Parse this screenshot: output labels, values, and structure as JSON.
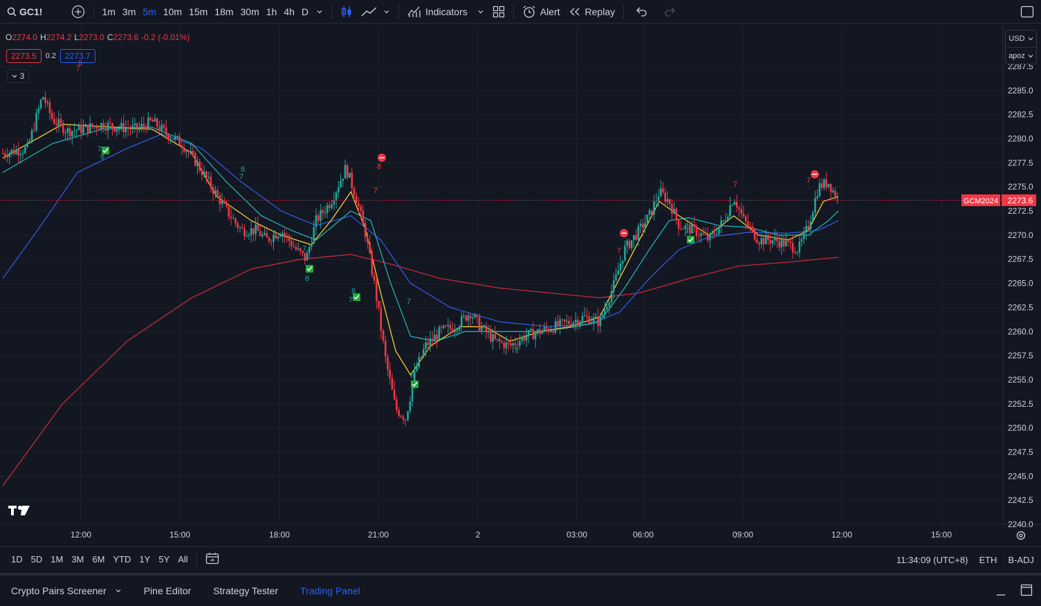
{
  "toolbar": {
    "symbol": "GC1!",
    "intervals": [
      "1m",
      "3m",
      "5m",
      "10m",
      "15m",
      "18m",
      "30m",
      "1h",
      "4h",
      "D"
    ],
    "active_interval": "5m",
    "indicators_label": "Indicators",
    "alert_label": "Alert",
    "replay_label": "Replay"
  },
  "legend": {
    "open_key": "O",
    "open": "2274.0",
    "high_key": "H",
    "high": "2274.2",
    "low_key": "L",
    "low": "2273.0",
    "close_key": "C",
    "close": "2273.6",
    "change": "-0.2 (-0.01%)",
    "sell_price": "2273.5",
    "spread": "0.2",
    "buy_price": "2273.7",
    "collapse_count": "3"
  },
  "scale": {
    "currency": "USD",
    "unit": "apoz",
    "price_labels": [
      "2287.5",
      "2285.0",
      "2282.5",
      "2280.0",
      "2277.5",
      "2275.0",
      "2272.5",
      "2270.0",
      "2267.5",
      "2265.0",
      "2262.5",
      "2260.0",
      "2257.5",
      "2255.0",
      "2252.5",
      "2250.0",
      "2247.5",
      "2245.0",
      "2242.5",
      "2240.0"
    ],
    "symbol_tag": "GCM2024",
    "last_price": "2273.6"
  },
  "time_axis": [
    "12:00",
    "15:00",
    "18:00",
    "21:00",
    "2",
    "03:00",
    "06:00",
    "09:00",
    "12:00",
    "15:00"
  ],
  "range_bar": {
    "ranges": [
      "1D",
      "5D",
      "1M",
      "3M",
      "6M",
      "YTD",
      "1Y",
      "5Y",
      "All"
    ],
    "clock": "11:34:09 (UTC+8)",
    "session": "ETH",
    "adjust": "B-ADJ"
  },
  "bottom_tabs": {
    "screener": "Crypto Pairs Screener",
    "pine": "Pine Editor",
    "strategy": "Strategy Tester",
    "trading": "Trading Panel"
  },
  "markers": {
    "seven": "7",
    "eight": "8"
  },
  "colors": {
    "background": "#131722",
    "up": "#26a69a",
    "down": "#f23645",
    "accent": "#2962ff",
    "ema_fast": "#f5d033",
    "ema_mid": "#21b1b5",
    "ema_slow": "#2f5bd8",
    "ema_long": "#c62a3a"
  },
  "chart_data": {
    "type": "candlestick",
    "x_ticks": [
      "12:00",
      "15:00",
      "18:00",
      "21:00",
      "2",
      "03:00",
      "06:00",
      "09:00",
      "12:00",
      "15:00"
    ],
    "ylim": [
      2240.0,
      2287.5
    ],
    "y_ticks": [
      2240.0,
      2242.5,
      2245.0,
      2247.5,
      2250.0,
      2252.5,
      2255.0,
      2257.5,
      2260.0,
      2262.5,
      2265.0,
      2267.5,
      2270.0,
      2272.5,
      2275.0,
      2277.5,
      2280.0,
      2282.5,
      2285.0,
      2287.5
    ],
    "price_path": [
      [
        0.0,
        2278.5
      ],
      [
        0.5,
        2279.0
      ],
      [
        0.8,
        2284.5
      ],
      [
        1.0,
        2282.0
      ],
      [
        1.3,
        2280.8
      ],
      [
        1.6,
        2281.0
      ],
      [
        2.0,
        2281.5
      ],
      [
        2.3,
        2281.2
      ],
      [
        2.7,
        2281.0
      ],
      [
        3.0,
        2281.8
      ],
      [
        3.3,
        2280.5
      ],
      [
        3.6,
        2279.5
      ],
      [
        3.9,
        2277.5
      ],
      [
        4.2,
        2275.0
      ],
      [
        4.5,
        2272.5
      ],
      [
        4.8,
        2270.5
      ],
      [
        5.1,
        2270.5
      ],
      [
        5.3,
        2269.5
      ],
      [
        5.6,
        2270.5
      ],
      [
        5.9,
        2268.5
      ],
      [
        6.1,
        2267.5
      ],
      [
        6.3,
        2271.5
      ],
      [
        6.6,
        2273.5
      ],
      [
        6.9,
        2277.0
      ],
      [
        7.1,
        2274.0
      ],
      [
        7.3,
        2270.0
      ],
      [
        7.5,
        2264.0
      ],
      [
        7.7,
        2257.0
      ],
      [
        7.9,
        2252.0
      ],
      [
        8.1,
        2251.0
      ],
      [
        8.3,
        2256.0
      ],
      [
        8.5,
        2258.5
      ],
      [
        8.8,
        2260.0
      ],
      [
        9.1,
        2260.5
      ],
      [
        9.4,
        2262.0
      ],
      [
        9.6,
        2260.5
      ],
      [
        9.9,
        2259.0
      ],
      [
        10.2,
        2258.5
      ],
      [
        10.5,
        2259.5
      ],
      [
        10.8,
        2260.0
      ],
      [
        11.1,
        2260.5
      ],
      [
        11.4,
        2261.0
      ],
      [
        11.7,
        2261.5
      ],
      [
        12.0,
        2261.0
      ],
      [
        12.3,
        2265.0
      ],
      [
        12.5,
        2268.5
      ],
      [
        12.8,
        2270.5
      ],
      [
        13.0,
        2272.0
      ],
      [
        13.2,
        2274.5
      ],
      [
        13.4,
        2273.5
      ],
      [
        13.6,
        2271.0
      ],
      [
        13.9,
        2270.5
      ],
      [
        14.2,
        2269.5
      ],
      [
        14.5,
        2271.5
      ],
      [
        14.7,
        2274.0
      ],
      [
        14.9,
        2271.5
      ],
      [
        15.2,
        2269.5
      ],
      [
        15.5,
        2269.5
      ],
      [
        15.8,
        2269.0
      ],
      [
        16.0,
        2268.5
      ],
      [
        16.2,
        2271.0
      ],
      [
        16.4,
        2275.0
      ],
      [
        16.6,
        2275.5
      ],
      [
        16.8,
        2273.6
      ]
    ],
    "series": [
      {
        "name": "",
        "color": "#f5d033",
        "values": [
          [
            0,
            2278.0
          ],
          [
            1.2,
            2281.5
          ],
          [
            2.2,
            2281.2
          ],
          [
            3.0,
            2281.0
          ],
          [
            3.8,
            2278.5
          ],
          [
            4.3,
            2274.0
          ],
          [
            5.0,
            2271.5
          ],
          [
            5.6,
            2270.0
          ],
          [
            6.2,
            2269.0
          ],
          [
            6.6,
            2271.5
          ],
          [
            7.0,
            2274.5
          ],
          [
            7.3,
            2270.5
          ],
          [
            7.6,
            2264.0
          ],
          [
            7.9,
            2258.0
          ],
          [
            8.2,
            2255.5
          ],
          [
            8.6,
            2258.5
          ],
          [
            9.2,
            2260.5
          ],
          [
            9.7,
            2260.5
          ],
          [
            10.2,
            2259.0
          ],
          [
            10.8,
            2260.0
          ],
          [
            11.4,
            2260.5
          ],
          [
            12.0,
            2261.5
          ],
          [
            12.4,
            2265.5
          ],
          [
            12.8,
            2269.5
          ],
          [
            13.2,
            2273.5
          ],
          [
            13.6,
            2272.0
          ],
          [
            14.2,
            2270.0
          ],
          [
            14.7,
            2272.0
          ],
          [
            15.2,
            2270.0
          ],
          [
            15.8,
            2269.5
          ],
          [
            16.2,
            2270.5
          ],
          [
            16.5,
            2273.5
          ],
          [
            16.8,
            2274.0
          ]
        ]
      },
      {
        "name": "",
        "color": "#21b1b5",
        "values": [
          [
            0,
            2276.5
          ],
          [
            1.0,
            2279.5
          ],
          [
            2.0,
            2281.0
          ],
          [
            3.0,
            2281.2
          ],
          [
            3.8,
            2279.5
          ],
          [
            4.5,
            2275.5
          ],
          [
            5.2,
            2272.0
          ],
          [
            5.8,
            2270.5
          ],
          [
            6.3,
            2269.5
          ],
          [
            7.0,
            2272.5
          ],
          [
            7.4,
            2271.5
          ],
          [
            7.8,
            2265.0
          ],
          [
            8.2,
            2259.5
          ],
          [
            8.7,
            2259.0
          ],
          [
            9.3,
            2260.0
          ],
          [
            10.0,
            2260.0
          ],
          [
            10.8,
            2260.0
          ],
          [
            11.5,
            2260.5
          ],
          [
            12.0,
            2261.0
          ],
          [
            12.5,
            2264.5
          ],
          [
            13.0,
            2268.5
          ],
          [
            13.4,
            2271.5
          ],
          [
            13.8,
            2271.8
          ],
          [
            14.4,
            2271.0
          ],
          [
            15.0,
            2270.8
          ],
          [
            15.6,
            2270.0
          ],
          [
            16.2,
            2270.0
          ],
          [
            16.6,
            2271.5
          ],
          [
            16.8,
            2272.5
          ]
        ]
      },
      {
        "name": "",
        "color": "#2f5bd8",
        "values": [
          [
            0,
            2265.5
          ],
          [
            0.7,
            2270.5
          ],
          [
            1.5,
            2276.5
          ],
          [
            2.5,
            2279.0
          ],
          [
            3.2,
            2280.5
          ],
          [
            4.0,
            2279.0
          ],
          [
            4.8,
            2275.5
          ],
          [
            5.6,
            2272.5
          ],
          [
            6.3,
            2271.0
          ],
          [
            7.0,
            2272.0
          ],
          [
            7.6,
            2269.5
          ],
          [
            8.2,
            2265.0
          ],
          [
            9.0,
            2262.5
          ],
          [
            10.0,
            2261.0
          ],
          [
            11.0,
            2260.5
          ],
          [
            11.8,
            2260.8
          ],
          [
            12.4,
            2262.0
          ],
          [
            13.0,
            2265.5
          ],
          [
            13.6,
            2268.5
          ],
          [
            14.2,
            2269.8
          ],
          [
            15.0,
            2270.3
          ],
          [
            15.8,
            2270.2
          ],
          [
            16.4,
            2270.5
          ],
          [
            16.8,
            2271.5
          ]
        ]
      },
      {
        "name": "",
        "color": "#c62a3a",
        "values": [
          [
            0,
            2244.0
          ],
          [
            1.2,
            2252.5
          ],
          [
            2.5,
            2259.0
          ],
          [
            3.8,
            2263.5
          ],
          [
            5.0,
            2266.5
          ],
          [
            6.0,
            2267.5
          ],
          [
            7.0,
            2268.0
          ],
          [
            7.8,
            2267.0
          ],
          [
            8.8,
            2265.5
          ],
          [
            10.0,
            2264.5
          ],
          [
            11.0,
            2264.0
          ],
          [
            12.0,
            2263.5
          ],
          [
            12.8,
            2264.0
          ],
          [
            13.8,
            2265.5
          ],
          [
            14.8,
            2266.8
          ],
          [
            15.8,
            2267.2
          ],
          [
            16.8,
            2267.7
          ]
        ]
      }
    ],
    "current_price": 2273.6,
    "grid": true
  }
}
